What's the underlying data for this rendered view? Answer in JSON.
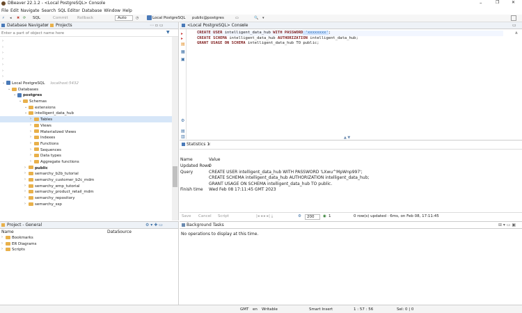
{
  "window": {
    "title": "DBeaver 22.1.2 - <Local PostgreSQL> Console",
    "min": "–",
    "max": "❐",
    "close": "✕"
  },
  "menu": [
    "File",
    "Edit",
    "Navigate",
    "Search",
    "SQL Editor",
    "Database",
    "Window",
    "Help"
  ],
  "toolbar": {
    "sql_label": "SQL",
    "commit": "Commit",
    "rollback": "Rollback",
    "mode": "Auto",
    "connection": "Local PostgreSQL",
    "schema": "public@postgres"
  },
  "navigator": {
    "tab1": "Database Navigator",
    "tab2": "Projects",
    "filter_placeholder": "Enter a part of object name here",
    "tree": [
      {
        "label": "Local PostgreSQL",
        "hint": "localhost:5432",
        "indent": 0
      },
      {
        "label": "Databases",
        "indent": 1
      },
      {
        "label": "postgres",
        "indent": 2,
        "bold": true
      },
      {
        "label": "Schemas",
        "indent": 3
      },
      {
        "label": "extensions",
        "indent": 4
      },
      {
        "label": "intelligent_data_hub",
        "indent": 4
      },
      {
        "label": "Tables",
        "indent": 5,
        "selected": true
      },
      {
        "label": "Views",
        "indent": 5
      },
      {
        "label": "Materialized Views",
        "indent": 5
      },
      {
        "label": "Indexes",
        "indent": 5
      },
      {
        "label": "Functions",
        "indent": 5
      },
      {
        "label": "Sequences",
        "indent": 5
      },
      {
        "label": "Data types",
        "indent": 5
      },
      {
        "label": "Aggregate functions",
        "indent": 5
      },
      {
        "label": "public",
        "indent": 4,
        "bold": true
      },
      {
        "label": "semarchy_b2b_tutorial",
        "indent": 4
      },
      {
        "label": "semarchy_customer_b2c_mdm",
        "indent": 4
      },
      {
        "label": "semarchy_emp_tutorial",
        "indent": 4
      },
      {
        "label": "semarchy_product_retail_mdm",
        "indent": 4
      },
      {
        "label": "semarchy_repository",
        "indent": 4
      },
      {
        "label": "semarchy_ssp",
        "indent": 4
      }
    ]
  },
  "editor": {
    "tab": "<Local PostgreSQL> Console",
    "line1_kw": "CREATE USER",
    "line1_name": " intelligent_data_hub ",
    "line1_kw2": "WITH PASSWORD",
    "line1_str": " 'xxxxxxxx'",
    "line1_end": ";",
    "line2_kw": "CREATE SCHEMA",
    "line2_name": " intelligent_data_hub ",
    "line2_kw2": "AUTHORIZATION",
    "line2_end": " intelligent_data_hub;",
    "line3_kw": "GRANT USAGE ON SCHEMA",
    "line3_end": " intelligent_data_hub TO public;"
  },
  "stats": {
    "tab": "Statistics 1",
    "col_name": "Name",
    "col_value": "Value",
    "rows": [
      {
        "name": "Updated Rows",
        "value": "0"
      },
      {
        "name": "Query",
        "value": "CREATE USER intelligent_data_hub WITH PASSWORD 'LXwu^MpWnp997';"
      },
      {
        "name": "",
        "value": "CREATE SCHEMA intelligent_data_hub AUTHORIZATION intelligent_data_hub;"
      },
      {
        "name": "",
        "value": "GRANT USAGE ON SCHEMA intelligent_data_hub TO public."
      },
      {
        "name": "Finish time",
        "value": "Wed Feb 08 17:11:45 GMT 2023"
      }
    ],
    "save": "Save",
    "cancel": "Cancel",
    "script": "Script",
    "limit": "200",
    "count": "1",
    "summary": "0 row(s) updated · 6ms, on Feb 08, 17:11:45"
  },
  "project": {
    "tab": "Project - General",
    "col_name": "Name",
    "col_ds": "DataSource",
    "items": [
      "Bookmarks",
      "ER Diagrams",
      "Scripts"
    ]
  },
  "tasks": {
    "tab": "Background Tasks",
    "empty": "No operations to display at this time."
  },
  "status": {
    "tz": "GMT",
    "lang": "en",
    "mode": "Writable",
    "insert": "Smart Insert",
    "pos": "1 : 57 : 56",
    "sel": "Sel: 0 | 0"
  }
}
